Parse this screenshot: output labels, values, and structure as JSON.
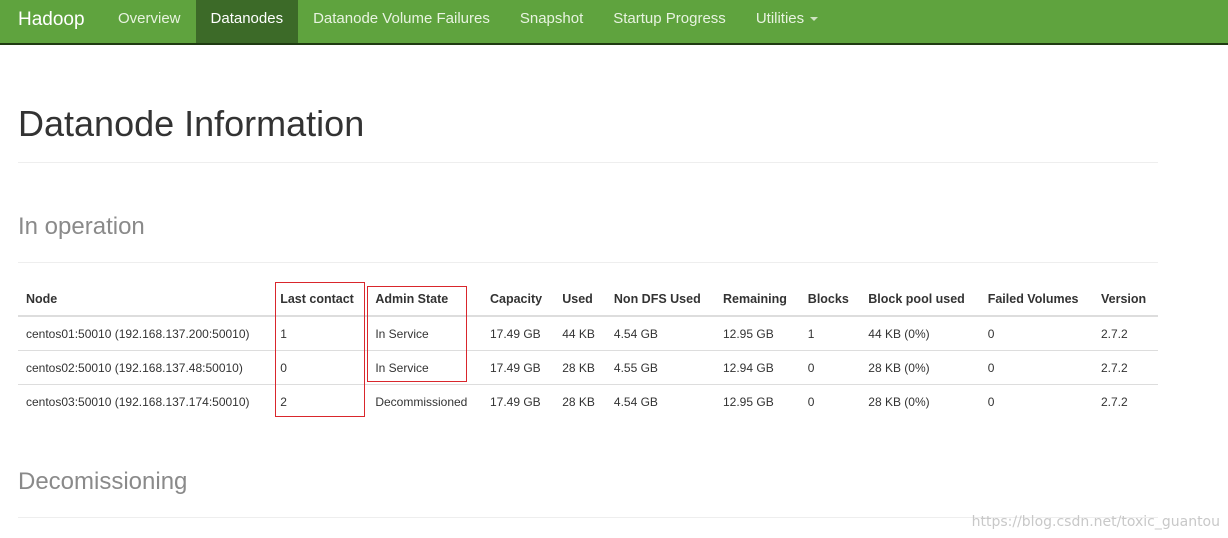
{
  "navbar": {
    "brand": "Hadoop",
    "items": [
      {
        "label": "Overview",
        "active": false
      },
      {
        "label": "Datanodes",
        "active": true
      },
      {
        "label": "Datanode Volume Failures",
        "active": false
      },
      {
        "label": "Snapshot",
        "active": false
      },
      {
        "label": "Startup Progress",
        "active": false
      },
      {
        "label": "Utilities",
        "active": false,
        "dropdown": true
      }
    ]
  },
  "page": {
    "title": "Datanode Information",
    "in_operation_title": "In operation",
    "decommissioning_title": "Decomissioning"
  },
  "table": {
    "headers": [
      "Node",
      "Last contact",
      "Admin State",
      "Capacity",
      "Used",
      "Non DFS Used",
      "Remaining",
      "Blocks",
      "Block pool used",
      "Failed Volumes",
      "Version"
    ],
    "rows": [
      [
        "centos01:50010 (192.168.137.200:50010)",
        "1",
        "In Service",
        "17.49 GB",
        "44 KB",
        "4.54 GB",
        "12.95 GB",
        "1",
        "44 KB (0%)",
        "0",
        "2.7.2"
      ],
      [
        "centos02:50010 (192.168.137.48:50010)",
        "0",
        "In Service",
        "17.49 GB",
        "28 KB",
        "4.55 GB",
        "12.94 GB",
        "0",
        "28 KB (0%)",
        "0",
        "2.7.2"
      ],
      [
        "centos03:50010 (192.168.137.174:50010)",
        "2",
        "Decommissioned",
        "17.49 GB",
        "28 KB",
        "4.54 GB",
        "12.95 GB",
        "0",
        "28 KB (0%)",
        "0",
        "2.7.2"
      ]
    ]
  },
  "watermark": "https://blog.csdn.net/toxic_guantou",
  "colors": {
    "navbar": "#5fa33e",
    "navbar_active": "#3c6a28",
    "highlight": "#d9262c"
  }
}
